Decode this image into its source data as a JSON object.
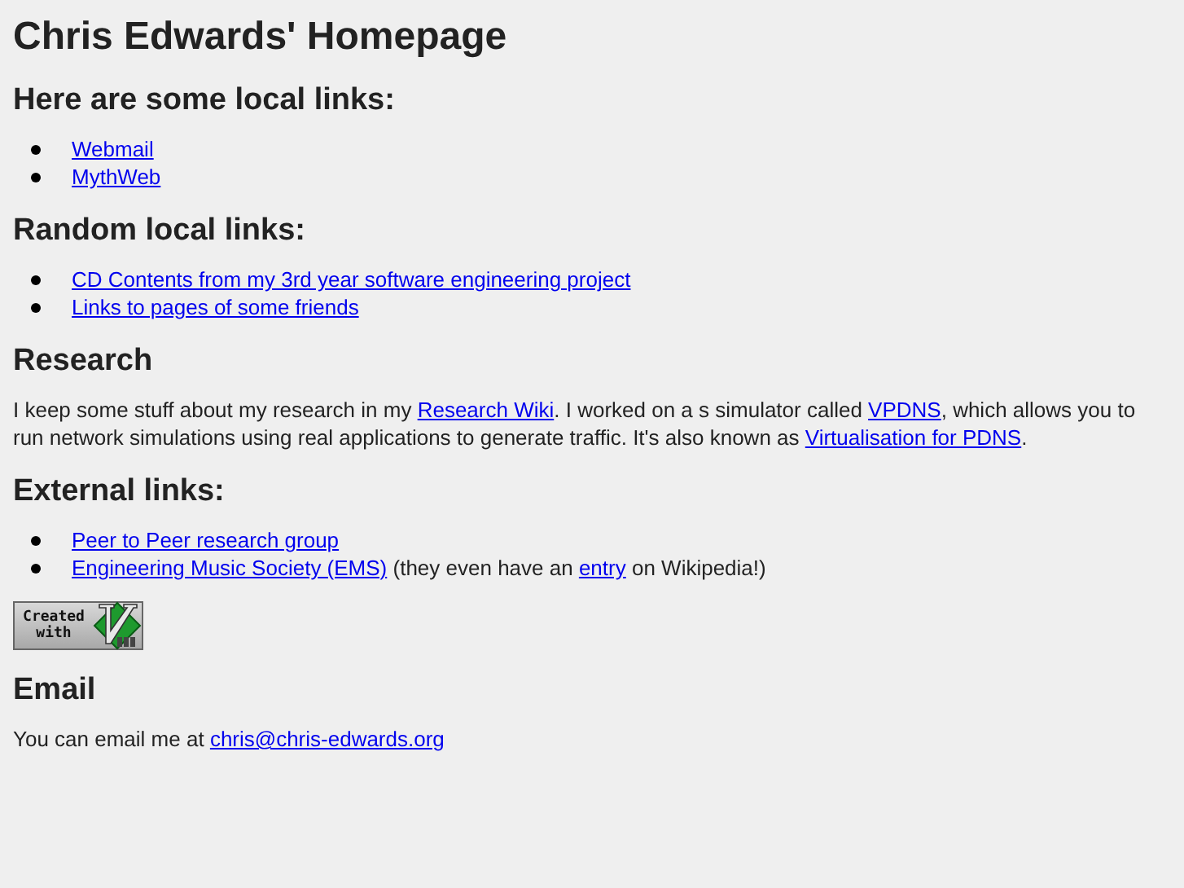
{
  "title": "Chris Edwards' Homepage",
  "sections": [
    {
      "kind": "list",
      "heading": "Here are some local links:",
      "items": [
        [
          {
            "kind": "link",
            "text": "Webmail"
          }
        ],
        [
          {
            "kind": "link",
            "text": "MythWeb"
          }
        ]
      ]
    },
    {
      "kind": "list",
      "heading": "Random local links:",
      "items": [
        [
          {
            "kind": "link",
            "text": "CD Contents from my 3rd year software engineering project"
          }
        ],
        [
          {
            "kind": "link",
            "text": "Links to pages of some friends"
          }
        ]
      ]
    },
    {
      "kind": "paragraph",
      "heading": "Research",
      "parts": [
        {
          "kind": "text",
          "text": "I keep some stuff about my research in my "
        },
        {
          "kind": "link",
          "text": "Research Wiki"
        },
        {
          "kind": "text",
          "text": ". I worked on a s simulator called "
        },
        {
          "kind": "link",
          "text": "VPDNS"
        },
        {
          "kind": "text",
          "text": ", which allows you to run network simulations using real applications to generate traffic. It's also known as "
        },
        {
          "kind": "link",
          "text": "Virtualisation for PDNS"
        },
        {
          "kind": "text",
          "text": "."
        }
      ]
    },
    {
      "kind": "list",
      "heading": "External links:",
      "items": [
        [
          {
            "kind": "link",
            "text": "Peer to Peer research group"
          }
        ],
        [
          {
            "kind": "link",
            "text": "Engineering Music Society (EMS)"
          },
          {
            "kind": "text",
            "text": " (they even have an "
          },
          {
            "kind": "link",
            "text": "entry"
          },
          {
            "kind": "text",
            "text": " on Wikipedia!)"
          }
        ]
      ]
    },
    {
      "kind": "badge",
      "text": "Created with"
    },
    {
      "kind": "paragraph",
      "heading": "Email",
      "parts": [
        {
          "kind": "text",
          "text": "You can email me at "
        },
        {
          "kind": "link",
          "text": "chris@chris-edwards.org"
        }
      ]
    }
  ]
}
